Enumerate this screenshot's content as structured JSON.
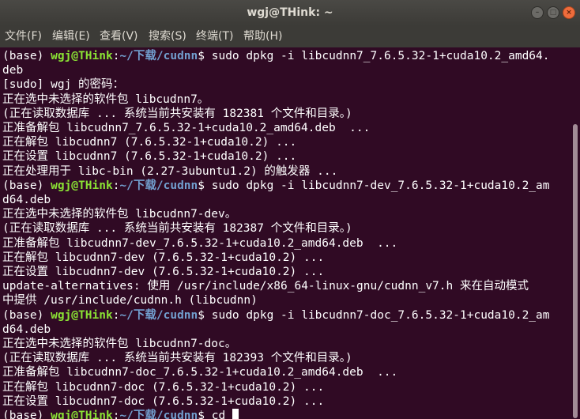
{
  "window": {
    "title": "wgj@THink: ~",
    "buttons": {
      "minimize": "–",
      "maximize": "□",
      "close": "×"
    }
  },
  "menu": [
    "文件(F)",
    "编辑(E)",
    "查看(V)",
    "搜索(S)",
    "终端(T)",
    "帮助(H)"
  ],
  "prompt": {
    "env": "(base) ",
    "user_host": "wgj@THink",
    "sep": ":",
    "path": "~/下载/cudnn",
    "symbol": "$ "
  },
  "lines": [
    {
      "type": "prompt",
      "cmd": "sudo dpkg -i libcudnn7_7.6.5.32-1+cuda10.2_amd64."
    },
    {
      "type": "text",
      "text": "deb"
    },
    {
      "type": "text",
      "text": "[sudo] wgj 的密码："
    },
    {
      "type": "text",
      "text": "正在选中未选择的软件包 libcudnn7。"
    },
    {
      "type": "text",
      "text": "(正在读取数据库 ... 系统当前共安装有 182381 个文件和目录。)"
    },
    {
      "type": "text",
      "text": "正准备解包 libcudnn7_7.6.5.32-1+cuda10.2_amd64.deb  ..."
    },
    {
      "type": "text",
      "text": "正在解包 libcudnn7 (7.6.5.32-1+cuda10.2) ..."
    },
    {
      "type": "text",
      "text": "正在设置 libcudnn7 (7.6.5.32-1+cuda10.2) ..."
    },
    {
      "type": "text",
      "text": "正在处理用于 libc-bin (2.27-3ubuntu1.2) 的触发器 ..."
    },
    {
      "type": "prompt",
      "cmd": "sudo dpkg -i libcudnn7-dev_7.6.5.32-1+cuda10.2_am"
    },
    {
      "type": "text",
      "text": "d64.deb"
    },
    {
      "type": "text",
      "text": "正在选中未选择的软件包 libcudnn7-dev。"
    },
    {
      "type": "text",
      "text": "(正在读取数据库 ... 系统当前共安装有 182387 个文件和目录。)"
    },
    {
      "type": "text",
      "text": "正准备解包 libcudnn7-dev_7.6.5.32-1+cuda10.2_amd64.deb  ..."
    },
    {
      "type": "text",
      "text": "正在解包 libcudnn7-dev (7.6.5.32-1+cuda10.2) ..."
    },
    {
      "type": "text",
      "text": "正在设置 libcudnn7-dev (7.6.5.32-1+cuda10.2) ..."
    },
    {
      "type": "text",
      "text": "update-alternatives: 使用 /usr/include/x86_64-linux-gnu/cudnn_v7.h 来在自动模式"
    },
    {
      "type": "text",
      "text": "中提供 /usr/include/cudnn.h (libcudnn)"
    },
    {
      "type": "prompt",
      "cmd": "sudo dpkg -i libcudnn7-doc_7.6.5.32-1+cuda10.2_am"
    },
    {
      "type": "text",
      "text": "d64.deb"
    },
    {
      "type": "text",
      "text": "正在选中未选择的软件包 libcudnn7-doc。"
    },
    {
      "type": "text",
      "text": "(正在读取数据库 ... 系统当前共安装有 182393 个文件和目录。)"
    },
    {
      "type": "text",
      "text": "正准备解包 libcudnn7-doc_7.6.5.32-1+cuda10.2_amd64.deb  ..."
    },
    {
      "type": "text",
      "text": "正在解包 libcudnn7-doc (7.6.5.32-1+cuda10.2) ..."
    },
    {
      "type": "text",
      "text": "正在设置 libcudnn7-doc (7.6.5.32-1+cuda10.2) ..."
    },
    {
      "type": "prompt",
      "cmd": "cd "
    }
  ],
  "colors": {
    "background": "#300a24",
    "user_host": "#8ae234",
    "path": "#729fcf",
    "text": "#ffffff"
  }
}
